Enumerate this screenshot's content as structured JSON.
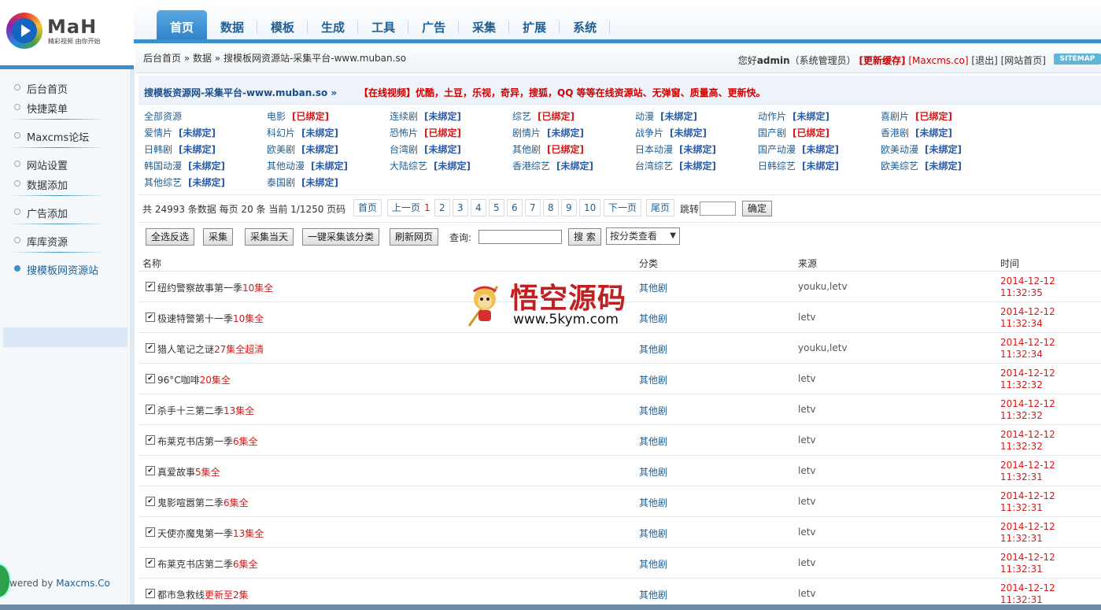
{
  "logo": {
    "brand": "MaH",
    "slogan": "精彩视频 由你开始"
  },
  "nav": [
    {
      "label": "首页",
      "active": true
    },
    {
      "label": "数据"
    },
    {
      "label": "模板"
    },
    {
      "label": "生成"
    },
    {
      "label": "工具"
    },
    {
      "label": "广告"
    },
    {
      "label": "采集"
    },
    {
      "label": "扩展"
    },
    {
      "label": "系统"
    }
  ],
  "breadcrumb": "后台首页 » 数据 » 搜模板网资源站-采集平台-www.muban.so",
  "user": {
    "greeting": "您好",
    "name": "admin",
    "role": "（系统管理员）",
    "cache": "[更新缓存]",
    "maxcms": "[Maxcms.co]",
    "logout": "[退出]",
    "home": "[网站首页]",
    "sitemap": "SITEMAP"
  },
  "sidebar": {
    "items": [
      "后台首页",
      "快捷菜单",
      "Maxcms论坛",
      "网站设置",
      "数据添加",
      "广告添加",
      "库库资源",
      "搜模板网资源站"
    ],
    "powered_prefix": "wered by ",
    "powered_link": "Maxcms.Co"
  },
  "info": {
    "site": "搜模板资源网-采集平台-www.muban.so »",
    "desc": "【在线视频】优酷，土豆，乐视，奇异，搜狐，QQ 等等在线资源站、无弹窗、质量高、更新快。"
  },
  "categories": [
    {
      "name": "全部资源",
      "status": ""
    },
    {
      "name": "电影",
      "status": "[已绑定]"
    },
    {
      "name": "连续剧",
      "status": "[未绑定]"
    },
    {
      "name": "综艺",
      "status": "[已绑定]"
    },
    {
      "name": "动漫",
      "status": "[未绑定]"
    },
    {
      "name": "动作片",
      "status": "[未绑定]"
    },
    {
      "name": "喜剧片",
      "status": "[已绑定]"
    },
    {
      "name": "爱情片",
      "status": "[未绑定]"
    },
    {
      "name": "科幻片",
      "status": "[未绑定]"
    },
    {
      "name": "恐怖片",
      "status": "[已绑定]"
    },
    {
      "name": "剧情片",
      "status": "[未绑定]"
    },
    {
      "name": "战争片",
      "status": "[未绑定]"
    },
    {
      "name": "国产剧",
      "status": "[已绑定]"
    },
    {
      "name": "香港剧",
      "status": "[未绑定]"
    },
    {
      "name": "日韩剧",
      "status": "[未绑定]"
    },
    {
      "name": "欧美剧",
      "status": "[未绑定]"
    },
    {
      "name": "台湾剧",
      "status": "[未绑定]"
    },
    {
      "name": "其他剧",
      "status": "[已绑定]"
    },
    {
      "name": "日本动漫",
      "status": "[未绑定]"
    },
    {
      "name": "国产动漫",
      "status": "[未绑定]"
    },
    {
      "name": "欧美动漫",
      "status": "[未绑定]"
    },
    {
      "name": "韩国动漫",
      "status": "[未绑定]"
    },
    {
      "name": "其他动漫",
      "status": "[未绑定]"
    },
    {
      "name": "大陆综艺",
      "status": "[未绑定]"
    },
    {
      "name": "香港综艺",
      "status": "[未绑定]"
    },
    {
      "name": "台湾综艺",
      "status": "[未绑定]"
    },
    {
      "name": "日韩综艺",
      "status": "[未绑定]"
    },
    {
      "name": "欧美综艺",
      "status": "[未绑定]"
    },
    {
      "name": "其他综艺",
      "status": "[未绑定]"
    },
    {
      "name": "泰国剧",
      "status": "[未绑定]"
    }
  ],
  "pager": {
    "summary": "共 24993 条数据 每页 20 条 当前 1/1250 页码",
    "first": "首页",
    "prev": "上一页",
    "pages": [
      "1",
      "2",
      "3",
      "4",
      "5",
      "6",
      "7",
      "8",
      "9",
      "10"
    ],
    "current": "1",
    "next": "下一页",
    "last": "尾页",
    "jump_label": "跳转",
    "confirm": "确定"
  },
  "toolbar": {
    "select_all": "全选反选",
    "collect": "采集",
    "collect_today": "采集当天",
    "collect_category": "一键采集该分类",
    "refresh": "刷新网页",
    "query_label": "查询:",
    "search": "搜 索",
    "category_select": "按分类查看"
  },
  "table": {
    "headers": [
      "名称",
      "分类",
      "来源",
      "时间"
    ],
    "rows": [
      {
        "title": "纽约警察故事第一季",
        "ep": "10集全",
        "category": "其他剧",
        "source": "youku,letv",
        "date": "2014-12-12",
        "time": "11:32:35"
      },
      {
        "title": "极速特警第十一季",
        "ep": "10集全",
        "category": "其他剧",
        "source": "letv",
        "date": "2014-12-12",
        "time": "11:32:34"
      },
      {
        "title": "猎人笔记之谜",
        "ep": "27集全超清",
        "category": "其他剧",
        "source": "youku,letv",
        "date": "2014-12-12",
        "time": "11:32:34"
      },
      {
        "title": "96°C咖啡",
        "ep": "20集全",
        "category": "其他剧",
        "source": "letv",
        "date": "2014-12-12",
        "time": "11:32:32"
      },
      {
        "title": "杀手十三第二季",
        "ep": "13集全",
        "category": "其他剧",
        "source": "letv",
        "date": "2014-12-12",
        "time": "11:32:32"
      },
      {
        "title": "布莱克书店第一季",
        "ep": "6集全",
        "category": "其他剧",
        "source": "letv",
        "date": "2014-12-12",
        "time": "11:32:32"
      },
      {
        "title": "真爱故事",
        "ep": "5集全",
        "category": "其他剧",
        "source": "letv",
        "date": "2014-12-12",
        "time": "11:32:31"
      },
      {
        "title": "鬼影喧嚣第二季",
        "ep": "6集全",
        "category": "其他剧",
        "source": "letv",
        "date": "2014-12-12",
        "time": "11:32:31"
      },
      {
        "title": "天使亦魔鬼第一季",
        "ep": "13集全",
        "category": "其他剧",
        "source": "letv",
        "date": "2014-12-12",
        "time": "11:32:31"
      },
      {
        "title": "布莱克书店第二季",
        "ep": "6集全",
        "category": "其他剧",
        "source": "letv",
        "date": "2014-12-12",
        "time": "11:32:31"
      },
      {
        "title": "都市急救线",
        "ep": "更新至2集",
        "category": "其他剧",
        "source": "letv",
        "date": "2014-12-12",
        "time": "11:32:31"
      }
    ]
  },
  "watermark": {
    "title": "悟空源码",
    "url": "www.5kym.com"
  },
  "colors": {
    "accent": "#3d8fcc",
    "link": "#1f5f94",
    "red": "#d31a1a"
  }
}
